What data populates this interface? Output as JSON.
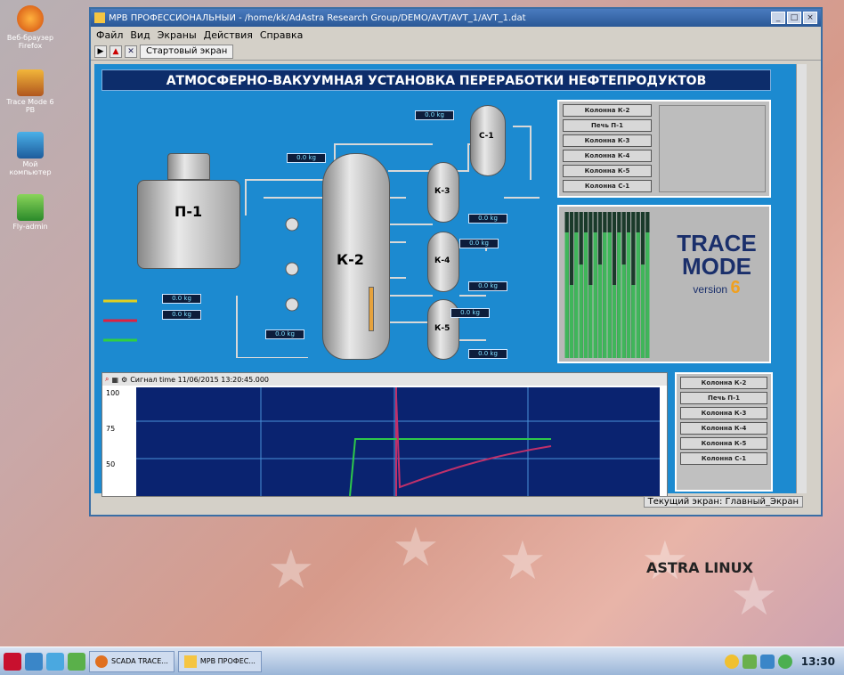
{
  "desktop": {
    "icons": [
      {
        "label": "Веб-браузер Firefox"
      },
      {
        "label": "Trace Mode 6 РВ"
      },
      {
        "label": "Мой компьютер"
      },
      {
        "label": "Fly-admin"
      }
    ],
    "brand": "ASTRA LINUX"
  },
  "window": {
    "title": "МРВ ПРОФЕССИОНАЛЬНЫЙ - /home/kk/AdAstra Research Group/DEMO/AVT/AVT_1/AVT_1.dat",
    "menu": [
      "Файл",
      "Вид",
      "Экраны",
      "Действия",
      "Справка"
    ],
    "tab": "Стартовый экран",
    "status": "Текущий экран: Главный_Экран"
  },
  "scada": {
    "title": "АТМОСФЕРНО-ВАКУУМНАЯ УСТАНОВКА ПЕРЕРАБОТКИ НЕФТЕПРОДУКТОВ",
    "furnace_label": "П-1",
    "column_label": "К-2",
    "column_small_labels": [
      "С-1",
      "К-3",
      "К-4",
      "К-5"
    ],
    "readouts": [
      "0.0 kg",
      "0.0 kg",
      "0.0 kg",
      "0.0 kg",
      "0.0 kg",
      "0.0 kg",
      "0.0 kg",
      "0.0 kg",
      "0.0 kg",
      "0.0 kg"
    ],
    "nav_top": [
      "Колонна К-2",
      "Печь П-1",
      "Колонна К-3",
      "Колонна К-4",
      "Колонна К-5",
      "Колонна С-1"
    ],
    "nav_bottom": [
      "Колонна К-2",
      "Печь П-1",
      "Колонна К-3",
      "Колонна К-4",
      "Колонна К-5",
      "Колонна С-1"
    ],
    "logo": {
      "line1": "TRACE",
      "line2": "MODE",
      "version": "version",
      "num": "6"
    },
    "trend_header": "Сигнал time 11/06/2015 13:20:45.000",
    "trend_ticks": [
      "100",
      "75",
      "50"
    ]
  },
  "bar_levels": [
    0.86,
    0.5,
    0.86,
    0.64,
    0.86,
    0.5,
    0.86,
    0.64,
    0.86,
    0.86,
    0.5,
    0.86,
    0.64,
    0.86,
    0.5,
    0.86,
    0.64,
    0.86
  ],
  "taskbar": {
    "tasks": [
      "SCADA TRACE...",
      "МРВ ПРОФЕС..."
    ],
    "clock": "13:30"
  },
  "colors": {
    "scada_bg": "#1c8ad0",
    "title_bg": "#0d2d6b",
    "trend_bg": "#0a2370",
    "green_line": "#2ec84a",
    "red_line": "#c0306a"
  }
}
